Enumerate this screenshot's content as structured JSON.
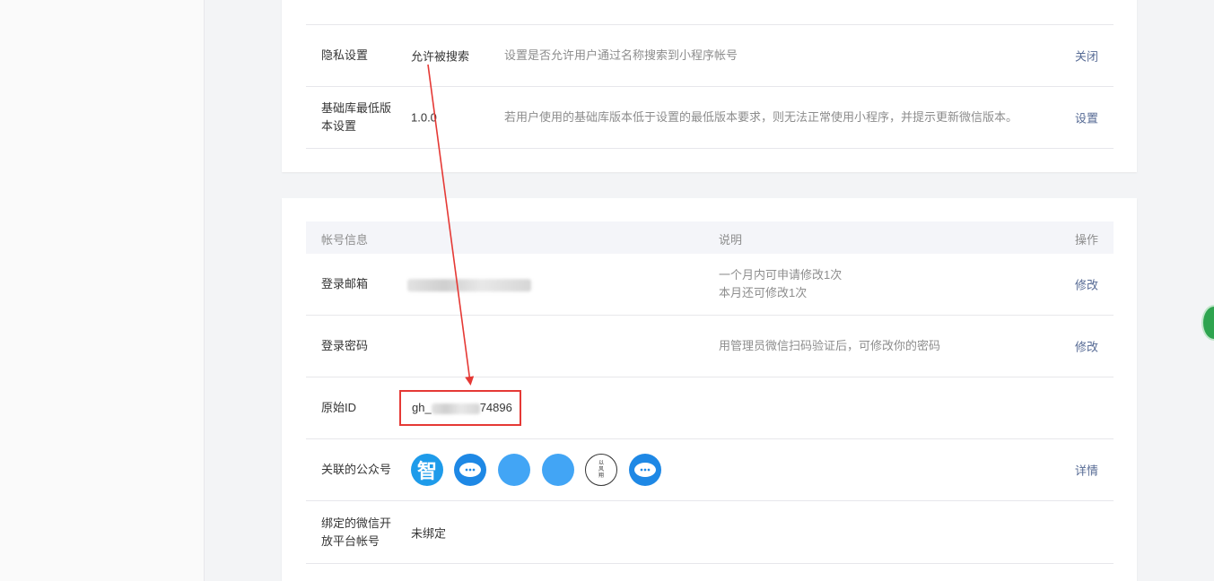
{
  "settings": {
    "privacy": {
      "label": "隐私设置",
      "value": "允许被搜索",
      "desc": "设置是否允许用户通过名称搜索到小程序帐号",
      "action": "关闭"
    },
    "base_lib": {
      "label_line1": "基础库最低版",
      "label_line2": "本设置",
      "value": "1.0.0",
      "desc": "若用户使用的基础库版本低于设置的最低版本要求，则无法正常使用小程序，并提示更新微信版本。",
      "action": "设置"
    }
  },
  "account": {
    "header": {
      "col1": "帐号信息",
      "col2": "说明",
      "col3": "操作"
    },
    "email": {
      "label": "登录邮箱",
      "desc_line1": "一个月内可申请修改1次",
      "desc_line2": "本月还可修改1次",
      "action": "修改"
    },
    "password": {
      "label": "登录密码",
      "desc": "用管理员微信扫码验证后，可修改你的密码",
      "action": "修改"
    },
    "original_id": {
      "label": "原始ID",
      "prefix": "gh_",
      "suffix": "74896"
    },
    "linked": {
      "label": "关联的公众号",
      "first_avatar_char": "智",
      "text_avatar": [
        "以",
        "风",
        "翔"
      ],
      "action": "详情"
    },
    "open_platform": {
      "label_line1": "绑定的微信开",
      "label_line2": "放平台帐号",
      "value": "未绑定"
    }
  },
  "colors": {
    "link": "#576b95",
    "highlight": "#e53935"
  }
}
